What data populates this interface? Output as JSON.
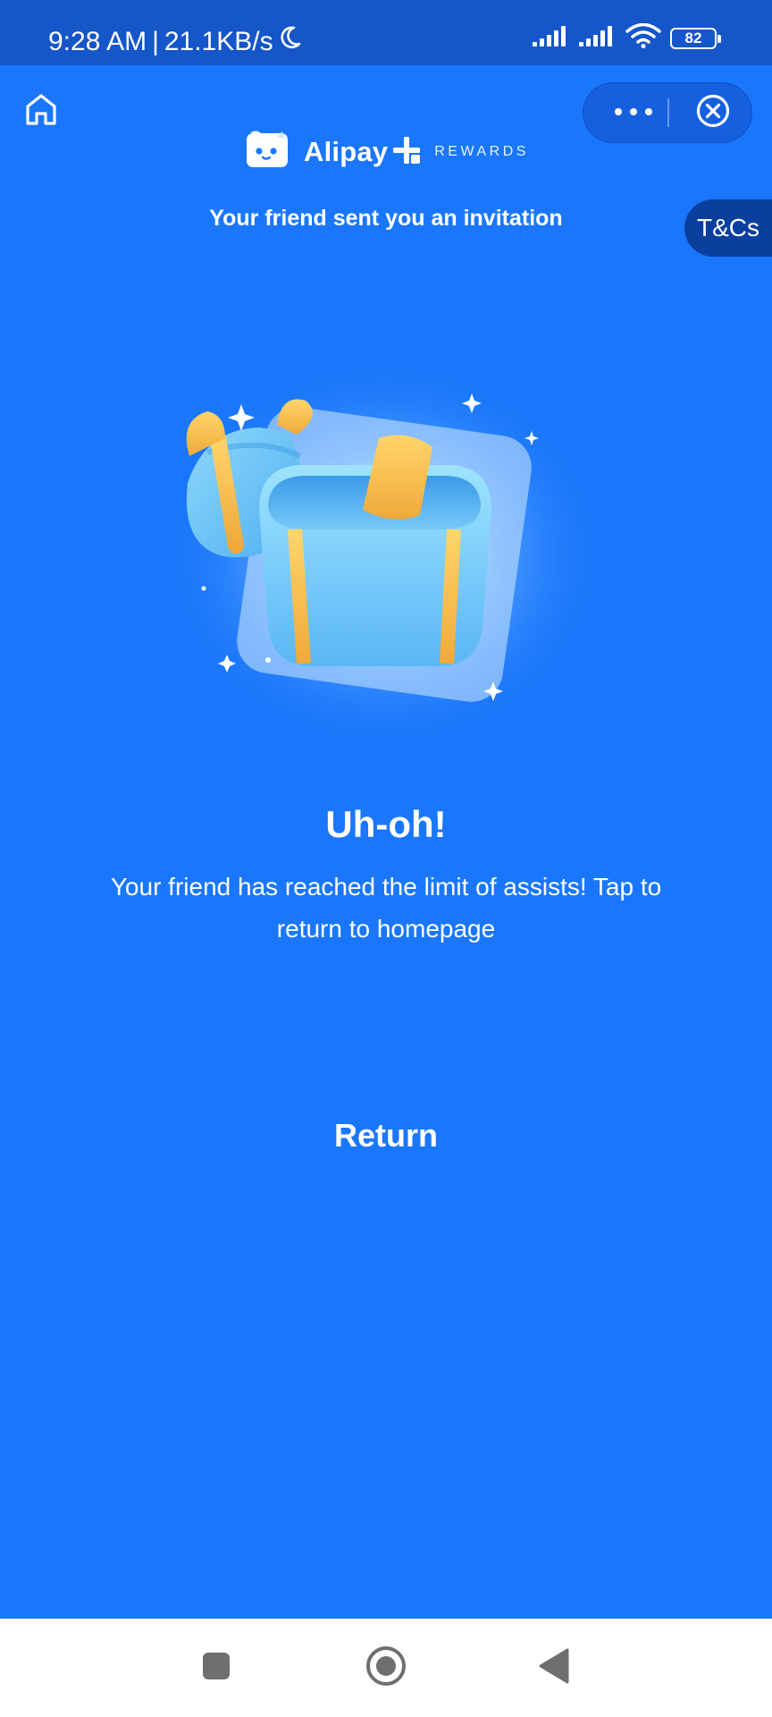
{
  "status_bar": {
    "time": "9:28 AM",
    "separator": "|",
    "network_speed": "21.1KB/s",
    "moon_icon": "do-not-disturb-moon-icon",
    "battery_level": "82",
    "icons": [
      "signal-icon",
      "signal-icon",
      "wifi-icon",
      "battery-icon"
    ]
  },
  "header": {
    "home_icon": "home-icon",
    "more_icon": "more-dots-icon",
    "close_icon": "close-circle-icon",
    "brand_name": "Alipay",
    "brand_plus": "+",
    "brand_sub": "REWARDS"
  },
  "invite_text": "Your friend sent you an invitation",
  "tcs_label": "T&Cs",
  "content": {
    "illustration": "open-gift-box",
    "title": "Uh-oh!",
    "message": "Your friend has reached the limit of assists! Tap to return to homepage",
    "return_label": "Return"
  },
  "nav_bar": {
    "recents_icon": "square-recents-icon",
    "home_icon": "circle-home-icon",
    "back_icon": "triangle-back-icon"
  },
  "colors": {
    "background": "#1a77fb",
    "status_bar": "#1556c8",
    "tcs_tab": "#0b3f9e",
    "gift_box": "#7fd0f8",
    "ribbon": "#f5b53d"
  }
}
